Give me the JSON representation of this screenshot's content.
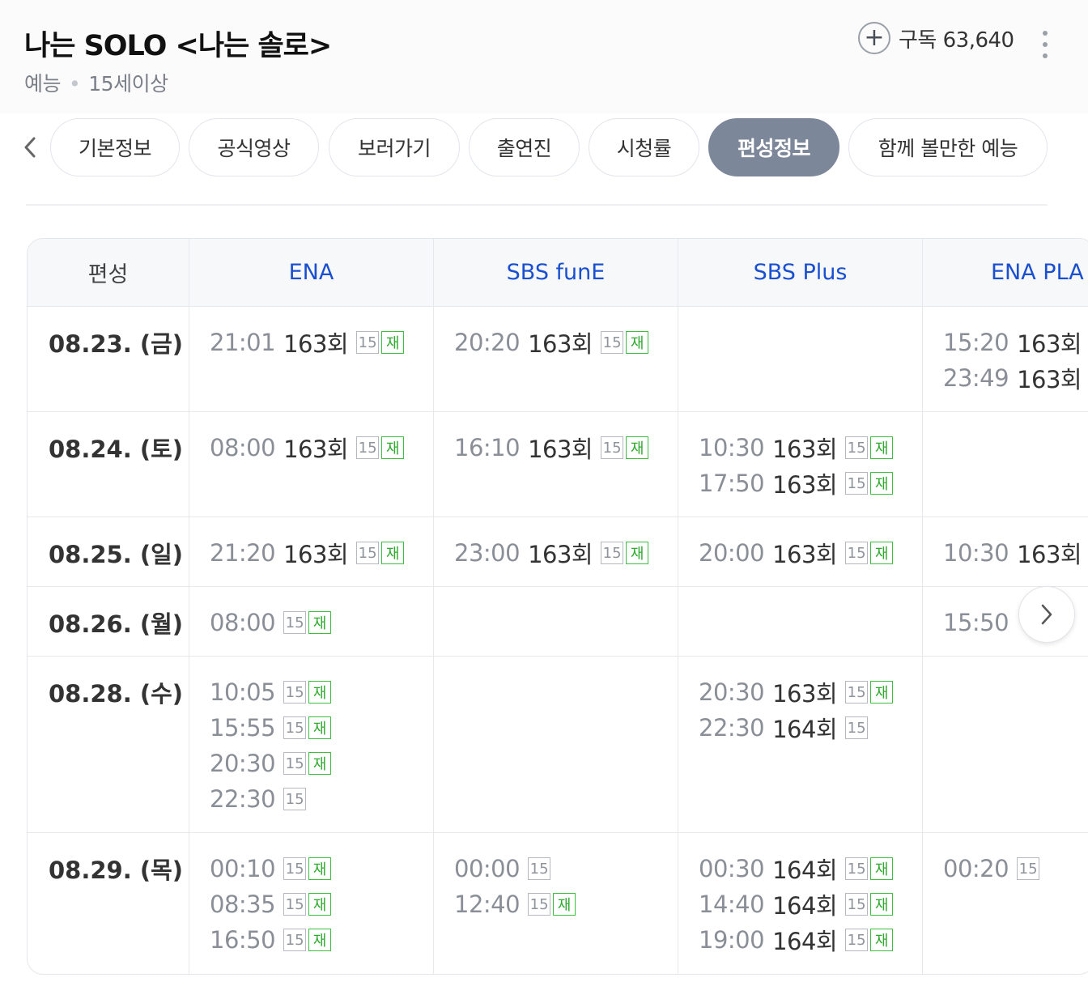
{
  "header": {
    "title": "나는 SOLO <나는 솔로>",
    "genre": "예능",
    "rating": "15세이상",
    "subscribe_label": "구독 63,640"
  },
  "icons": {
    "subscribe": "plus-circle-icon",
    "more": "more-vertical-icon",
    "prev": "chevron-left-icon",
    "next": "chevron-right-icon"
  },
  "tabs": [
    {
      "label": "기본정보",
      "active": false
    },
    {
      "label": "공식영상",
      "active": false
    },
    {
      "label": "보러가기",
      "active": false
    },
    {
      "label": "출연진",
      "active": false
    },
    {
      "label": "시청률",
      "active": false
    },
    {
      "label": "편성정보",
      "active": true
    },
    {
      "label": "함께 볼만한 예능",
      "active": false
    }
  ],
  "schedule": {
    "corner_label": "편성",
    "channels": [
      "ENA",
      "SBS funE",
      "SBS Plus",
      "ENA PLA"
    ],
    "rows": [
      {
        "date": "08.23. (금)",
        "cells": [
          [
            {
              "time": "21:01",
              "ep": "163회",
              "age": "15",
              "re": "재"
            }
          ],
          [
            {
              "time": "20:20",
              "ep": "163회",
              "age": "15",
              "re": "재"
            }
          ],
          [],
          [
            {
              "time": "15:20",
              "ep": "163회",
              "age": "",
              "re": ""
            },
            {
              "time": "23:49",
              "ep": "163회",
              "age": "",
              "re": ""
            }
          ]
        ]
      },
      {
        "date": "08.24. (토)",
        "cells": [
          [
            {
              "time": "08:00",
              "ep": "163회",
              "age": "15",
              "re": "재"
            }
          ],
          [
            {
              "time": "16:10",
              "ep": "163회",
              "age": "15",
              "re": "재"
            }
          ],
          [
            {
              "time": "10:30",
              "ep": "163회",
              "age": "15",
              "re": "재"
            },
            {
              "time": "17:50",
              "ep": "163회",
              "age": "15",
              "re": "재"
            }
          ],
          []
        ]
      },
      {
        "date": "08.25. (일)",
        "cells": [
          [
            {
              "time": "21:20",
              "ep": "163회",
              "age": "15",
              "re": "재"
            }
          ],
          [
            {
              "time": "23:00",
              "ep": "163회",
              "age": "15",
              "re": "재"
            }
          ],
          [
            {
              "time": "20:00",
              "ep": "163회",
              "age": "15",
              "re": "재"
            }
          ],
          [
            {
              "time": "10:30",
              "ep": "163회",
              "age": "",
              "re": ""
            }
          ]
        ]
      },
      {
        "date": "08.26. (월)",
        "cells": [
          [
            {
              "time": "08:00",
              "ep": "",
              "age": "15",
              "re": "재"
            }
          ],
          [],
          [],
          [
            {
              "time": "15:50",
              "ep": "",
              "age": "",
              "re": ""
            }
          ]
        ]
      },
      {
        "date": "08.28. (수)",
        "cells": [
          [
            {
              "time": "10:05",
              "ep": "",
              "age": "15",
              "re": "재"
            },
            {
              "time": "15:55",
              "ep": "",
              "age": "15",
              "re": "재"
            },
            {
              "time": "20:30",
              "ep": "",
              "age": "15",
              "re": "재"
            },
            {
              "time": "22:30",
              "ep": "",
              "age": "15",
              "re": ""
            }
          ],
          [],
          [
            {
              "time": "20:30",
              "ep": "163회",
              "age": "15",
              "re": "재"
            },
            {
              "time": "22:30",
              "ep": "164회",
              "age": "15",
              "re": ""
            }
          ],
          []
        ]
      },
      {
        "date": "08.29. (목)",
        "cells": [
          [
            {
              "time": "00:10",
              "ep": "",
              "age": "15",
              "re": "재"
            },
            {
              "time": "08:35",
              "ep": "",
              "age": "15",
              "re": "재"
            },
            {
              "time": "16:50",
              "ep": "",
              "age": "15",
              "re": "재"
            }
          ],
          [
            {
              "time": "00:00",
              "ep": "",
              "age": "15",
              "re": ""
            },
            {
              "time": "12:40",
              "ep": "",
              "age": "15",
              "re": "재"
            }
          ],
          [
            {
              "time": "00:30",
              "ep": "164회",
              "age": "15",
              "re": "재"
            },
            {
              "time": "14:40",
              "ep": "164회",
              "age": "15",
              "re": "재"
            },
            {
              "time": "19:00",
              "ep": "164회",
              "age": "15",
              "re": "재"
            }
          ],
          [
            {
              "time": "00:20",
              "ep": "",
              "age": "15",
              "re": ""
            }
          ]
        ]
      }
    ]
  }
}
